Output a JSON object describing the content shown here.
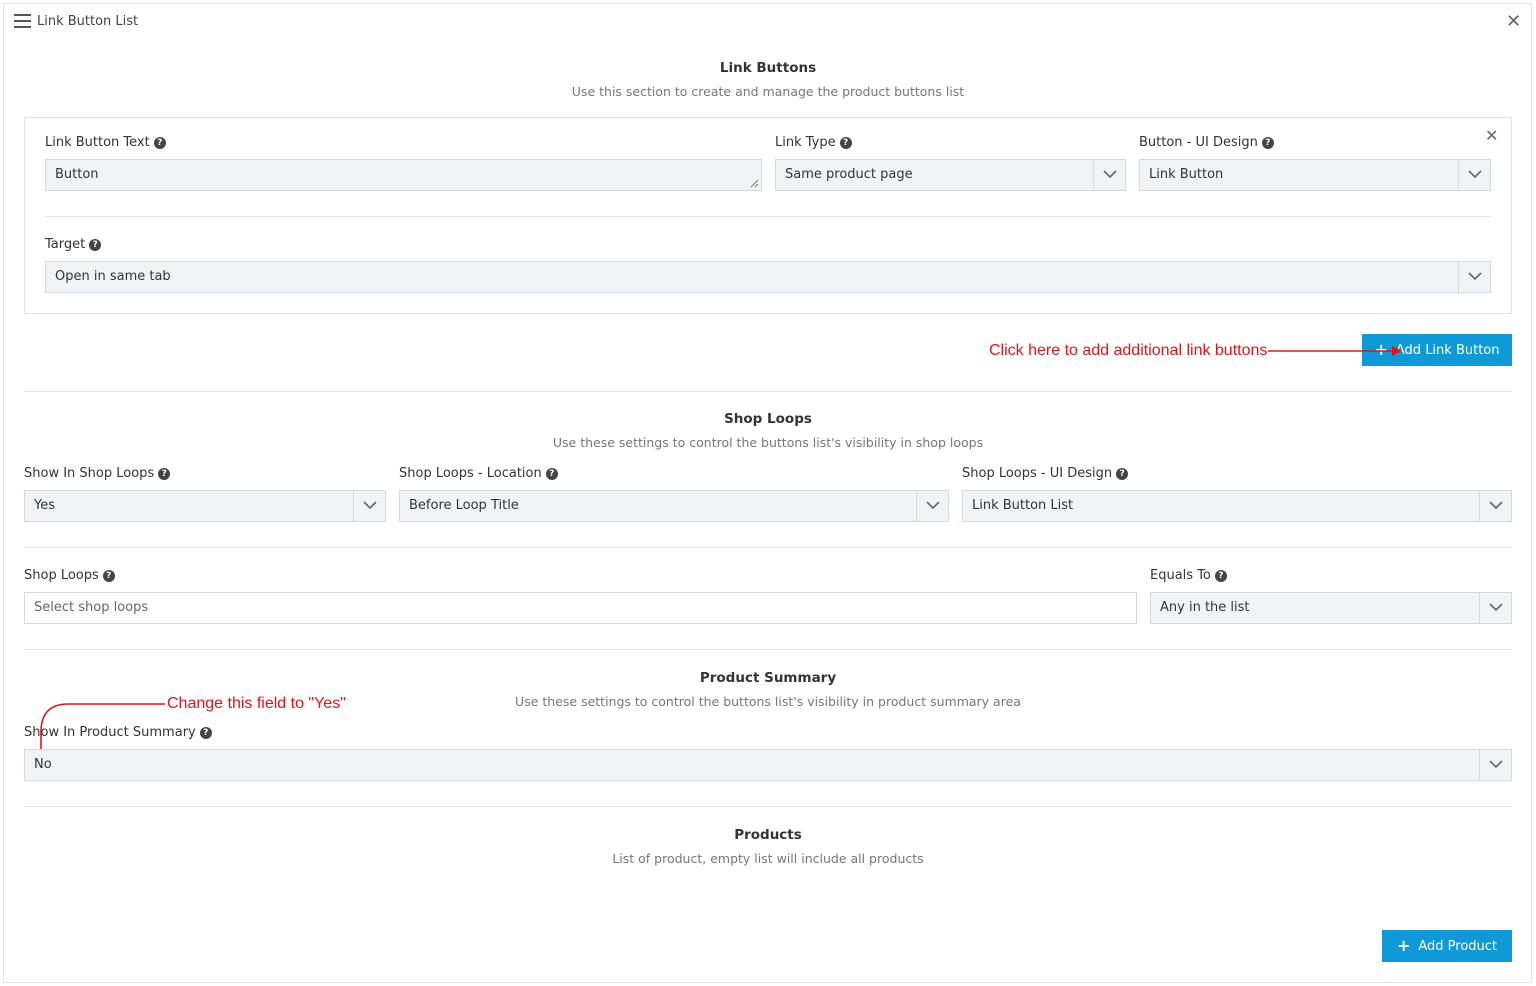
{
  "header": {
    "title": "Link Button List"
  },
  "link_buttons": {
    "title": "Link Buttons",
    "subtitle": "Use this section to create and manage the product buttons list",
    "link_button_text": {
      "label": "Link Button Text",
      "value": "Button"
    },
    "link_type": {
      "label": "Link Type",
      "value": "Same product page"
    },
    "button_ui_design": {
      "label": "Button - UI Design",
      "value": "Link Button"
    },
    "target": {
      "label": "Target",
      "value": "Open in same tab"
    },
    "add_button_label": "Add Link Button"
  },
  "shop_loops": {
    "title": "Shop Loops",
    "subtitle": "Use these settings to control the buttons list's visibility in shop loops",
    "show_in_shop_loops": {
      "label": "Show In Shop Loops",
      "value": "Yes"
    },
    "location": {
      "label": "Shop Loops - Location",
      "value": "Before Loop Title"
    },
    "ui_design": {
      "label": "Shop Loops - UI Design",
      "value": "Link Button List"
    },
    "shop_loops_field": {
      "label": "Shop Loops",
      "placeholder": "Select shop loops"
    },
    "equals_to": {
      "label": "Equals To",
      "value": "Any in the list"
    }
  },
  "product_summary": {
    "title": "Product Summary",
    "subtitle": "Use these settings to control the buttons list's visibility in product summary area",
    "show_in_product_summary": {
      "label": "Show In Product Summary",
      "value": "No"
    }
  },
  "products": {
    "title": "Products",
    "subtitle": "List of product, empty list will include all products",
    "add_button_label": "Add Product"
  },
  "annotations": {
    "add_link_hint": "Click here to add additional link buttons",
    "summary_hint": "Change this field to \"Yes\""
  },
  "colors": {
    "accent": "#0f99d6",
    "annotation": "#e2141a",
    "field_bg": "#f1f4f6"
  },
  "icons": [
    "hamburger-icon",
    "close-icon",
    "help-icon",
    "chevron-down-icon",
    "plus-icon",
    "resize-handle-icon"
  ]
}
